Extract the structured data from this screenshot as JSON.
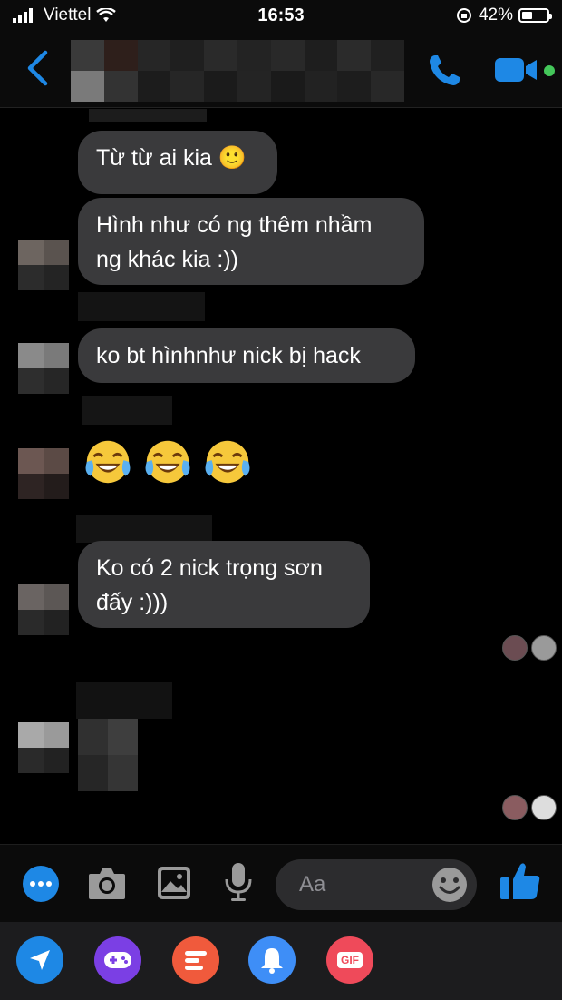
{
  "status_bar": {
    "carrier": "Viettel",
    "time": "16:53",
    "battery": "42%",
    "battery_level": 0.42
  },
  "messages": [
    {
      "text": "Từ từ ai kia 🙂"
    },
    {
      "text_line1": "Hình như có ng thêm nhầm",
      "text_line2": "ng khác kia :))"
    },
    {
      "text": "ko bt hìnhnhư nick bị hack"
    },
    {
      "emojis": [
        "😂",
        "😂",
        "😂"
      ]
    },
    {
      "text_line1": "Ko có 2 nick trọng sơn",
      "text_line2": "đấy :)))"
    }
  ],
  "composer": {
    "placeholder": "Aa"
  },
  "apps": {
    "gif_label": "GIF"
  },
  "colors": {
    "accent": "#1e88e5",
    "bubble": "#3a3a3c",
    "online": "#44c75a"
  }
}
